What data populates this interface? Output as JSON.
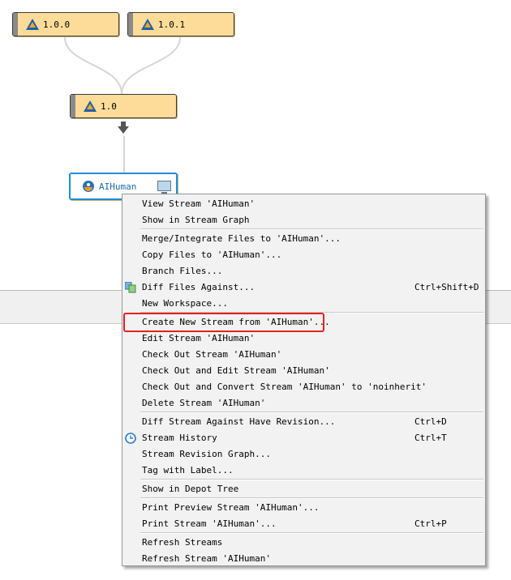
{
  "graph": {
    "nodes": [
      {
        "label": "1.0.0"
      },
      {
        "label": "1.0.1"
      },
      {
        "label": "1.0"
      },
      {
        "label": "AIHuman"
      }
    ]
  },
  "menu": {
    "groups": [
      [
        {
          "label": "View Stream 'AIHuman'"
        },
        {
          "label": "Show in Stream Graph"
        }
      ],
      [
        {
          "label": "Merge/Integrate Files to 'AIHuman'..."
        },
        {
          "label": "Copy Files to 'AIHuman'..."
        },
        {
          "label": "Branch Files..."
        },
        {
          "label": "Diff Files Against...",
          "shortcut": "Ctrl+Shift+D",
          "icon": "diff-files-icon"
        },
        {
          "label": "New Workspace..."
        }
      ],
      [
        {
          "label": "Create New Stream from 'AIHuman'..."
        },
        {
          "label": "Edit Stream 'AIHuman'"
        },
        {
          "label": "Check Out Stream 'AIHuman'"
        },
        {
          "label": "Check Out and Edit Stream 'AIHuman'"
        },
        {
          "label": "Check Out and Convert Stream 'AIHuman' to 'noinherit'"
        },
        {
          "label": "Delete Stream 'AIHuman'"
        }
      ],
      [
        {
          "label": "Diff Stream Against Have Revision...",
          "shortcut": "Ctrl+D"
        },
        {
          "label": "Stream History",
          "shortcut": "Ctrl+T",
          "icon": "clock-icon"
        },
        {
          "label": "Stream Revision Graph..."
        },
        {
          "label": "Tag with Label..."
        }
      ],
      [
        {
          "label": "Show in Depot Tree"
        }
      ],
      [
        {
          "label": "Print Preview Stream 'AIHuman'..."
        },
        {
          "label": "Print Stream 'AIHuman'...",
          "shortcut": "Ctrl+P"
        }
      ],
      [
        {
          "label": "Refresh Streams"
        },
        {
          "label": "Refresh Stream 'AIHuman'"
        }
      ]
    ]
  },
  "colors": {
    "node_fill": "#fddc9a",
    "active_border": "#1e8fd6",
    "highlight": "#e4211f"
  }
}
